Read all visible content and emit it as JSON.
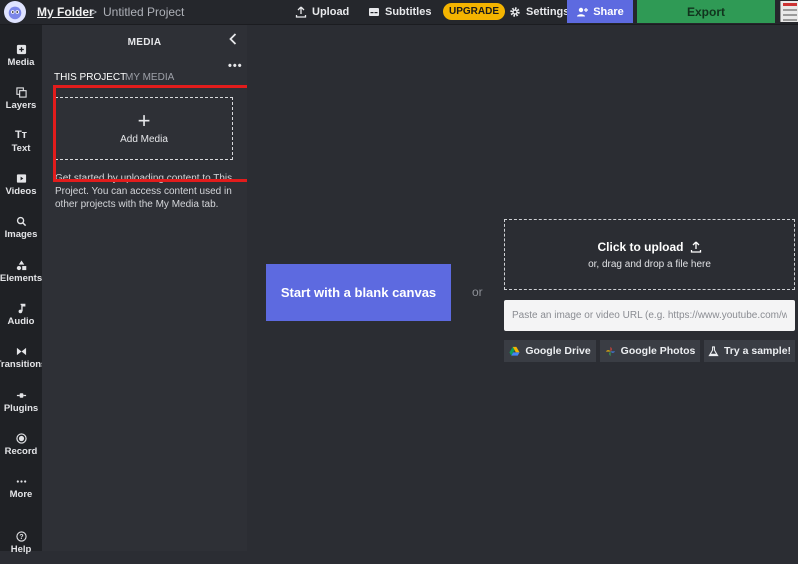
{
  "header": {
    "folder": "My Folder",
    "separator": ">",
    "project": "Untitled Project",
    "upload": "Upload",
    "subtitles": "Subtitles",
    "upgrade": "UPGRADE",
    "settings": "Settings",
    "share": "Share",
    "export": "Export"
  },
  "sidebar": {
    "items": [
      {
        "label": "Media",
        "icon": "media-icon"
      },
      {
        "label": "Layers",
        "icon": "layers-icon"
      },
      {
        "label": "Text",
        "icon": "text-icon"
      },
      {
        "label": "Videos",
        "icon": "videos-icon"
      },
      {
        "label": "Images",
        "icon": "search-icon"
      },
      {
        "label": "Elements",
        "icon": "elements-icon"
      },
      {
        "label": "Audio",
        "icon": "music-note-icon"
      },
      {
        "label": "Transitions",
        "icon": "transitions-icon"
      },
      {
        "label": "Plugins",
        "icon": "plugins-icon"
      },
      {
        "label": "Record",
        "icon": "record-icon"
      },
      {
        "label": "More",
        "icon": "more-icon"
      },
      {
        "label": "Help",
        "icon": "help-icon"
      }
    ]
  },
  "panel": {
    "title": "MEDIA",
    "more": "•••",
    "tabs": [
      "THIS PROJECT",
      "MY MEDIA"
    ],
    "add_media": "Add Media",
    "help_text": "Get started by uploading content to This Project. You can access content used in other projects with the My Media tab."
  },
  "main": {
    "blank_canvas": "Start with a blank canvas",
    "or": "or",
    "dropzone_title": "Click to upload",
    "dropzone_sub": "or, drag and drop a file here",
    "url_placeholder": "Paste an image or video URL (e.g. https://www.youtube.com/wa",
    "google_drive": "Google Drive",
    "google_photos": "Google Photos",
    "try_sample": "Try a sample!"
  },
  "colors": {
    "accent": "#5d6ae0",
    "export": "#2f9a55",
    "upgrade": "#f4b400",
    "highlight": "#e21c1c"
  }
}
